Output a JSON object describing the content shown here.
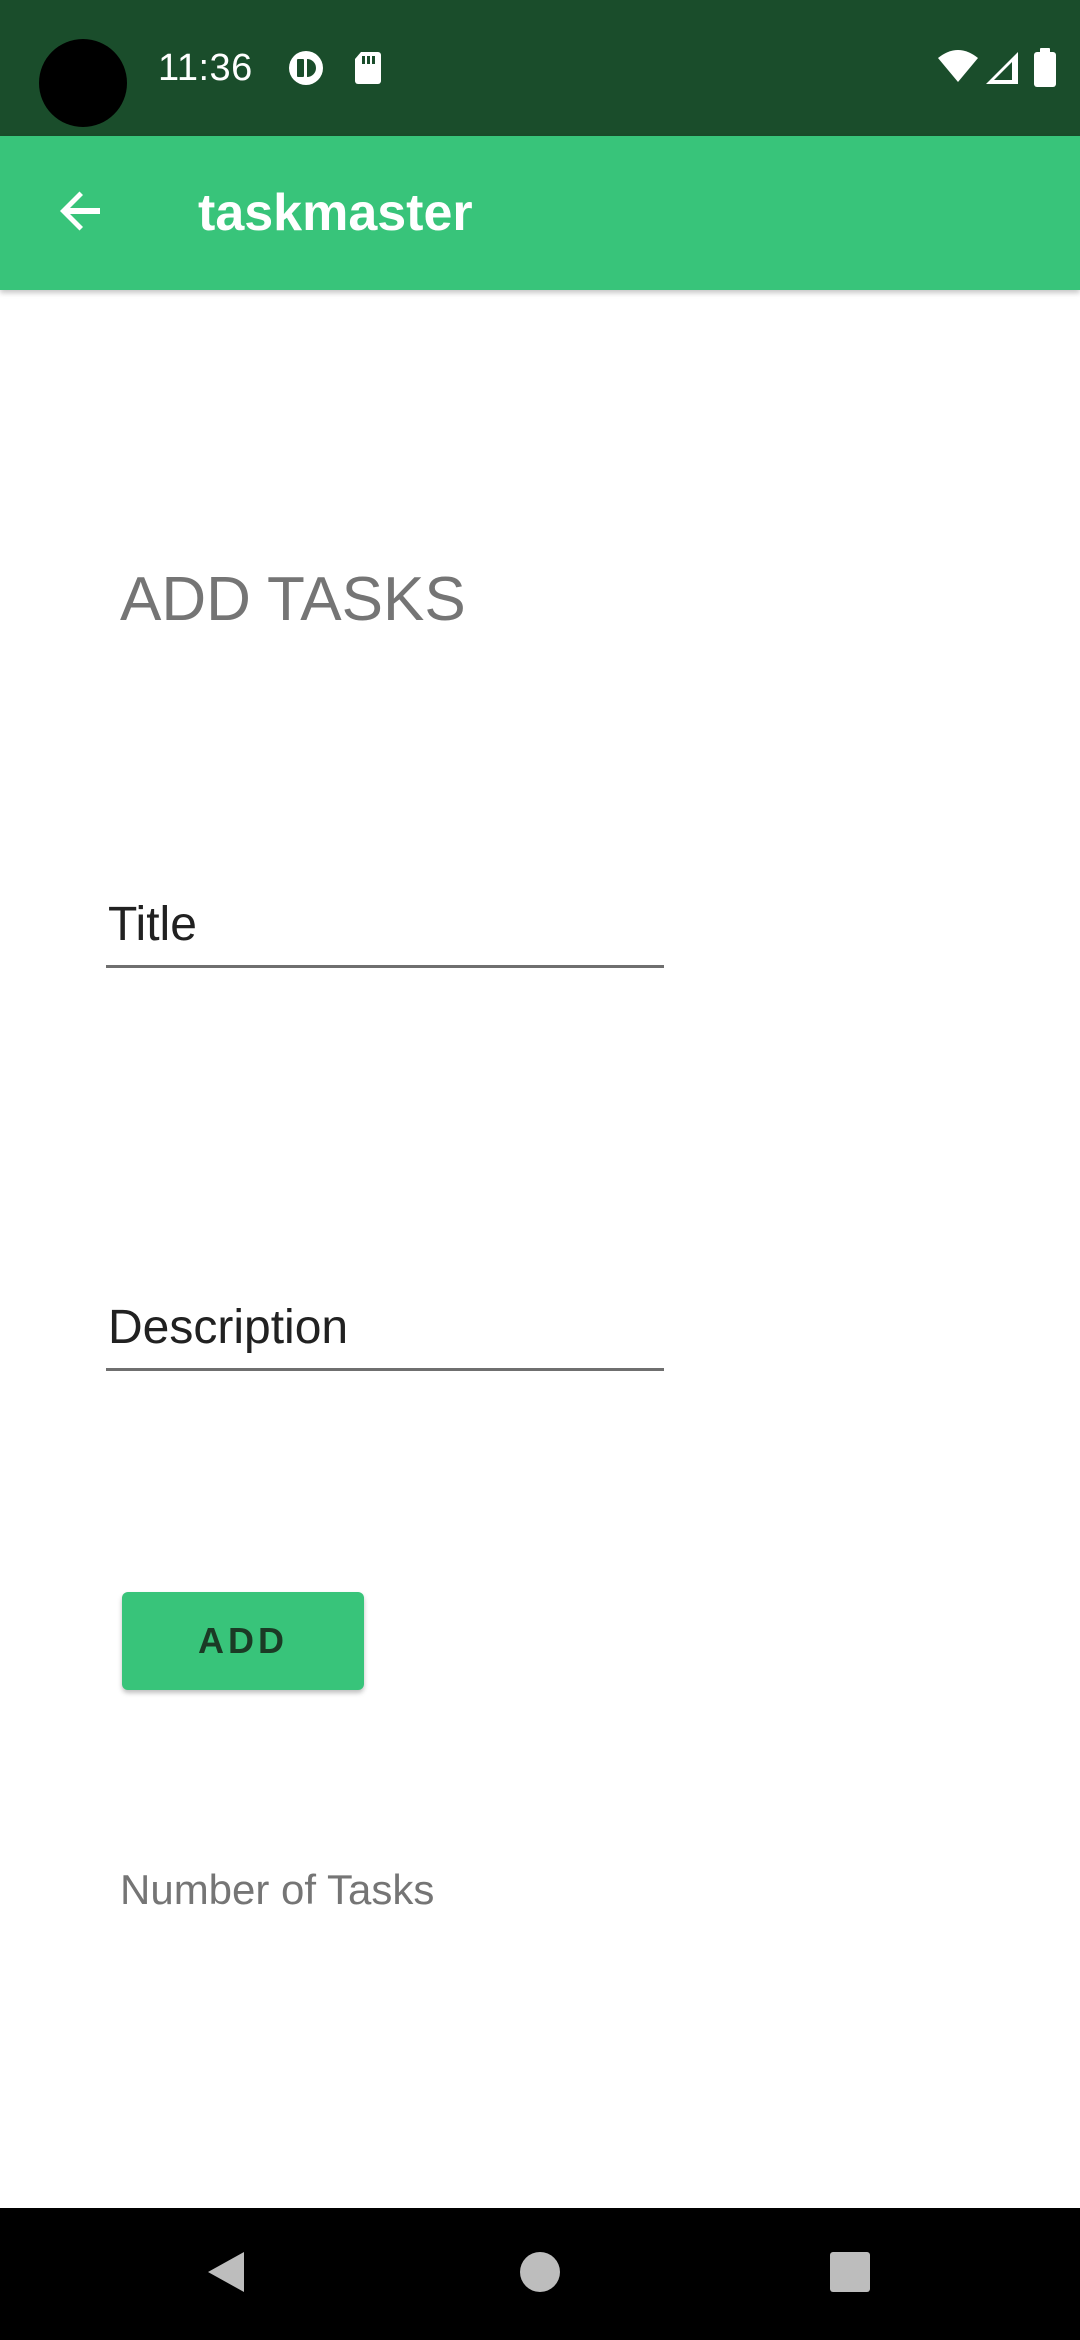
{
  "status_bar": {
    "time": "11:36",
    "left_icons": [
      "data-saver-icon",
      "sd-card-icon"
    ],
    "right_icons": [
      "wifi-icon",
      "cellular-signal-icon",
      "battery-icon"
    ],
    "background_color": "#1a4d2b"
  },
  "app_bar": {
    "title": "taskmaster",
    "back_icon": "arrow-back-icon",
    "background_color": "#38c47a"
  },
  "form": {
    "heading": "ADD TASKS",
    "title_field": {
      "placeholder": "Title",
      "value": ""
    },
    "description_field": {
      "placeholder": "Description",
      "value": ""
    },
    "add_button_label": "ADD",
    "task_count_label": "Number of Tasks"
  },
  "nav_bar": {
    "buttons": [
      "nav-back-icon",
      "nav-home-icon",
      "nav-recents-icon"
    ]
  },
  "colors": {
    "accent": "#38c47a",
    "status_bar": "#1a4d2b",
    "heading_text": "#757575"
  }
}
